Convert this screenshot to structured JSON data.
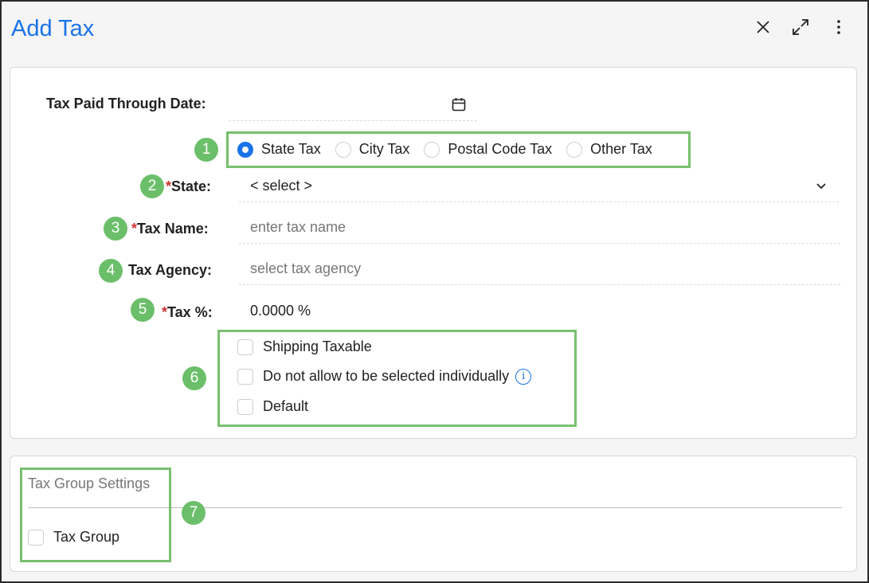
{
  "dialog": {
    "title": "Add Tax",
    "close_icon": "close-icon",
    "expand_icon": "expand-icon",
    "more_icon": "more-vertical-icon"
  },
  "form": {
    "paid_through": {
      "label": "Tax Paid Through Date:",
      "value": "",
      "icon": "calendar-icon"
    },
    "tax_type": {
      "options": [
        "State Tax",
        "City Tax",
        "Postal Code Tax",
        "Other Tax"
      ],
      "selected": "State Tax"
    },
    "state": {
      "required_mark": "*",
      "label": "State:",
      "value": "< select >",
      "icon": "chevron-down-icon"
    },
    "tax_name": {
      "required_mark": "*",
      "label": "Tax Name:",
      "placeholder": "enter tax name"
    },
    "tax_agency": {
      "label": "Tax Agency:",
      "placeholder": "select tax agency"
    },
    "tax_percent": {
      "required_mark": "*",
      "label": "Tax %:",
      "value": "0.0000 %"
    },
    "checkboxes": {
      "shipping": "Shipping Taxable",
      "individual": "Do not allow to be selected individually",
      "default": "Default",
      "info_icon": "info-icon"
    }
  },
  "group_settings": {
    "title": "Tax Group Settings",
    "tax_group": "Tax Group"
  },
  "badges": [
    "1",
    "2",
    "3",
    "4",
    "5",
    "6",
    "7"
  ],
  "colors": {
    "accent": "#1a73e8",
    "highlight": "#78c06e",
    "badge": "#6cbf6a",
    "required": "#d03030"
  }
}
